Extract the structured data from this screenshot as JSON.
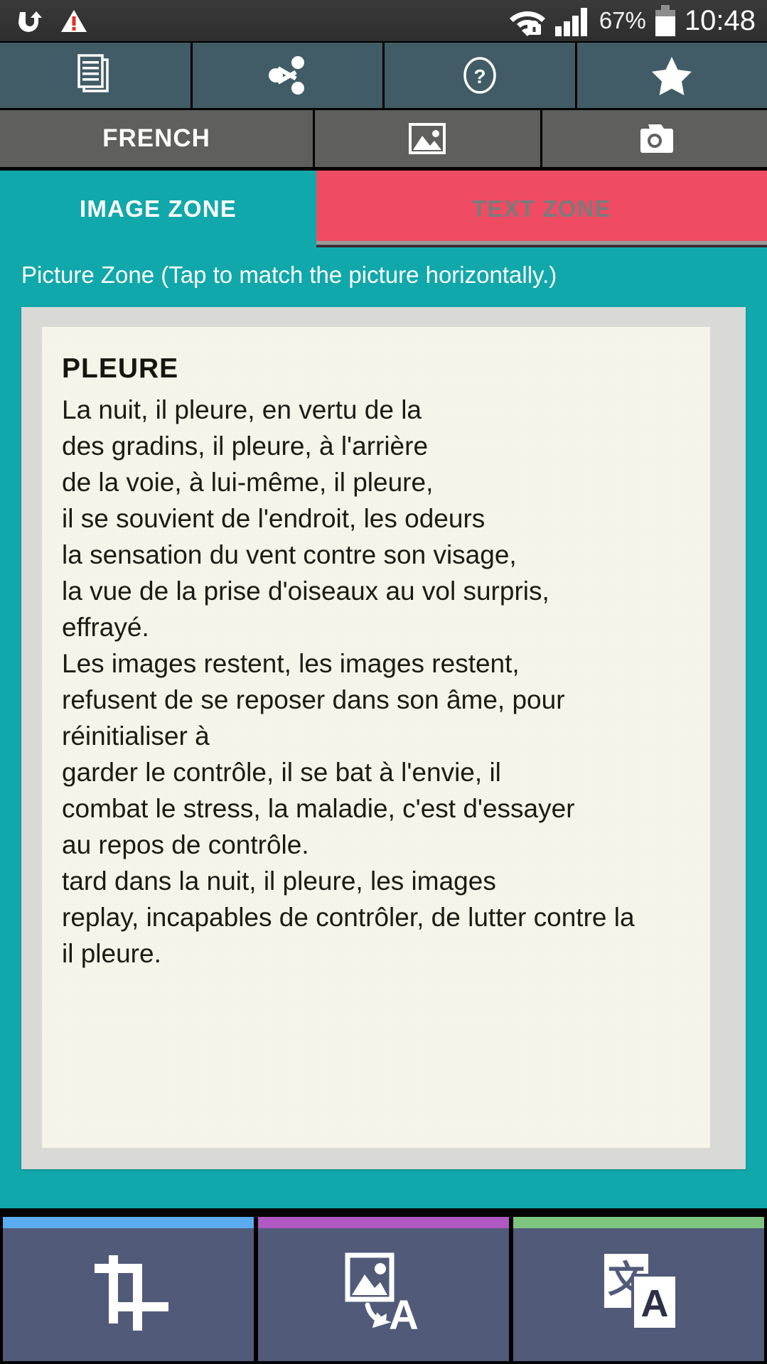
{
  "statusbar": {
    "battery_percent": "67%",
    "clock": "10:48",
    "icons": [
      "app-notification-icon",
      "warning-icon",
      "wifi-lock-icon",
      "signal-bars-icon",
      "battery-icon"
    ]
  },
  "toolbar_primary": {
    "background": "#415c66",
    "buttons": [
      {
        "name": "documents-button",
        "icon": "documents-icon"
      },
      {
        "name": "share-button",
        "icon": "share-icon"
      },
      {
        "name": "help-button",
        "icon": "question-circle-icon"
      },
      {
        "name": "favorite-button",
        "icon": "star-icon"
      }
    ]
  },
  "toolbar_secondary": {
    "background": "#5f5f5d",
    "language_label": "FRENCH",
    "buttons": [
      {
        "name": "gallery-button",
        "icon": "picture-icon"
      },
      {
        "name": "camera-button",
        "icon": "camera-icon"
      }
    ]
  },
  "tabs": {
    "active_index": 0,
    "items": [
      {
        "label": "IMAGE ZONE",
        "color": "#11a8ab",
        "active": true
      },
      {
        "label": "TEXT ZONE",
        "color": "#ef4b63",
        "active": false
      }
    ]
  },
  "image_zone": {
    "caption": "Picture Zone (Tap to match the picture horizontally.)",
    "background": "#11a8ab",
    "document": {
      "title": "PLEURE",
      "lines": [
        "La nuit, il pleure, en vertu de la",
        "des gradins, il pleure, à l'arrière",
        "de la voie, à lui-même, il pleure,",
        "il se souvient de l'endroit, les odeurs",
        "la sensation du vent contre son visage,",
        "la vue de la prise d'oiseaux au vol surpris,",
        "effrayé.",
        "Les images restent, les images restent,",
        "refusent de se reposer dans son âme, pour",
        "réinitialiser à",
        "garder le contrôle, il se bat à l'envie, il",
        "combat le stress, la maladie, c'est d'essayer",
        "au repos de contrôle.",
        "tard dans la nuit, il pleure, les images",
        "replay, incapables de contrôler, de lutter contre la",
        "il pleure."
      ]
    }
  },
  "bottom_bar": {
    "background": "#525a7a",
    "buttons": [
      {
        "name": "crop-button",
        "icon": "crop-icon",
        "accent": "#5aabf0"
      },
      {
        "name": "image-to-text-button",
        "icon": "image-to-text-icon",
        "accent": "#b058c2"
      },
      {
        "name": "translate-button",
        "icon": "translate-icon",
        "accent": "#7cc47f"
      }
    ]
  }
}
